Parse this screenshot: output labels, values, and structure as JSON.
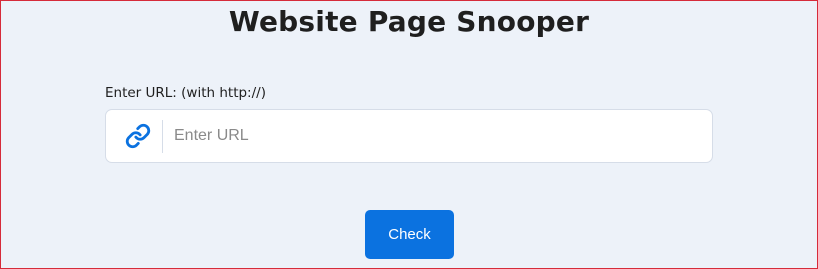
{
  "page": {
    "title": "Website Page Snooper"
  },
  "form": {
    "url_label": "Enter URL: (with http://)",
    "url_placeholder": "Enter URL",
    "url_value": "",
    "link_icon": "link-icon",
    "submit_label": "Check"
  },
  "colors": {
    "accent": "#0b72e0",
    "background": "#edf2f9",
    "frame_border": "#d62b3a"
  }
}
